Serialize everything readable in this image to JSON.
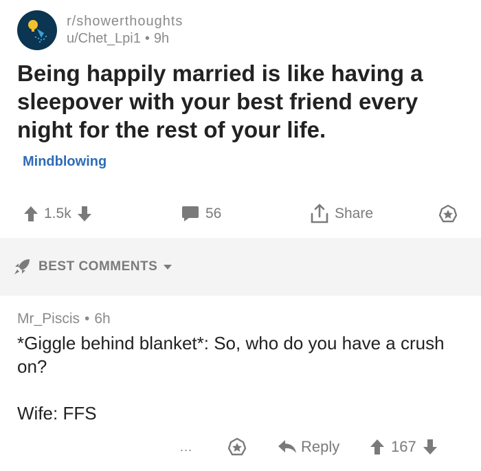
{
  "post": {
    "subreddit": "r/showerthoughts",
    "author": "u/Chet_Lpi1",
    "age": "9h",
    "title": "Being happily married is like having a sleepover with your best friend every night for the rest of your life.",
    "flair": "Mindblowing",
    "flair_color": "#2d6bb5",
    "score": "1.5k",
    "comment_count": "56",
    "share_label": "Share"
  },
  "comments_section": {
    "sort_label": "BEST COMMENTS"
  },
  "comment": {
    "author": "Mr_Piscis",
    "age": "6h",
    "paragraphs": [
      "*Giggle behind blanket*: So, who do you have a crush on?",
      "Wife: FFS"
    ],
    "more_label": "...",
    "reply_label": "Reply",
    "score": "167"
  },
  "icons": {
    "avatar": "shower-head-icon",
    "upvote": "arrow-up-icon",
    "downvote": "arrow-down-icon",
    "comments": "speech-bubble-icon",
    "share": "share-icon",
    "save": "star-icon",
    "sort": "rocket-icon",
    "reply": "reply-arrow-icon"
  }
}
